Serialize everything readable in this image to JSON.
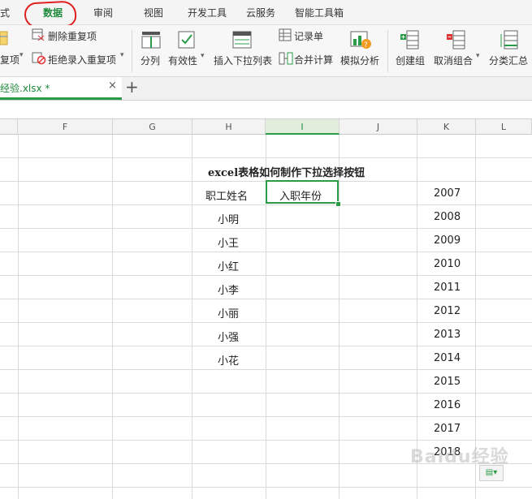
{
  "menu": {
    "items": [
      {
        "label": "式"
      },
      {
        "label": "数据"
      },
      {
        "label": "审阅"
      },
      {
        "label": "视图"
      },
      {
        "label": "开发工具"
      },
      {
        "label": "云服务"
      },
      {
        "label": "智能工具箱"
      }
    ],
    "active_index": 1
  },
  "toolbar": {
    "remove_duplicates": "删除重复项",
    "duplicates": "复项",
    "reject_duplicates": "拒绝录入重复项",
    "split": "分列",
    "validation": "有效性",
    "insert_dropdown": "插入下拉列表",
    "record_form": "记录单",
    "merge_calc": "合并计算",
    "what_if": "模拟分析",
    "create_group": "创建组",
    "ungroup": "取消组合",
    "subtotal": "分类汇总"
  },
  "file_tab": {
    "name": "经验.xlsx *",
    "close": "×",
    "add": "+"
  },
  "sheet": {
    "columns": [
      "F",
      "G",
      "H",
      "I",
      "J",
      "K",
      "L"
    ],
    "selected_column": "I",
    "title": "excel表格如何制作下拉选择按钮",
    "header_name": "职工姓名",
    "header_year": "入职年份",
    "names": [
      "小明",
      "小王",
      "小红",
      "小李",
      "小丽",
      "小强",
      "小花"
    ],
    "years": [
      "2007",
      "2008",
      "2009",
      "2010",
      "2011",
      "2012",
      "2013",
      "2014",
      "2015",
      "2016",
      "2017",
      "2018"
    ]
  },
  "watermark": "Baidu经验",
  "colors": {
    "accent": "#2b9b48",
    "annotation": "#e02020"
  }
}
